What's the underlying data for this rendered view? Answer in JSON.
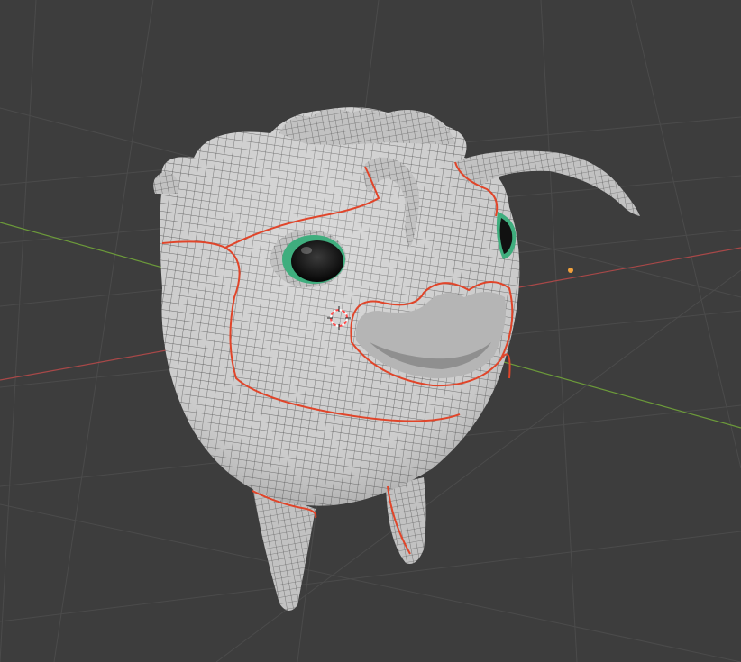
{
  "viewport": {
    "mode": "3d-viewport",
    "shading": "solid-wireframe-overlay",
    "colors": {
      "background": "#3d3d3d",
      "grid_line": "#4a4a4a",
      "axis_x": "#b04545",
      "axis_y": "#6e9c3c",
      "mesh_surface": "#c8c8c8",
      "wireframe": "#3a3a3a",
      "seam": "#e0452a",
      "eye_iris": "#3fae7e",
      "eye_pupil": "#111111",
      "light_point": "#f0a03c",
      "cursor_ring": "#ff5a5a"
    }
  },
  "scene": {
    "objects": [
      {
        "name": "creature-mesh",
        "icon": "mesh-icon"
      },
      {
        "name": "light",
        "icon": "light-point-icon"
      },
      {
        "name": "3d-cursor",
        "icon": "cursor-crosshair-icon"
      }
    ]
  }
}
